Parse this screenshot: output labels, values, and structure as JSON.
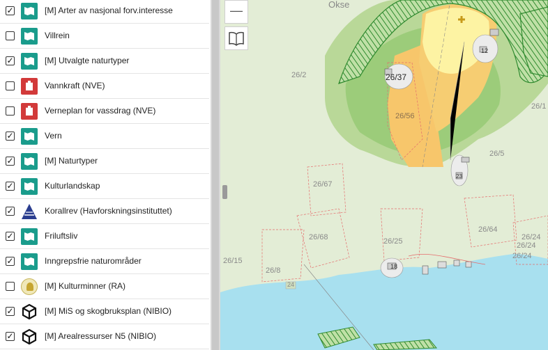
{
  "layers": [
    {
      "label": "[M] Arter av nasjonal forv.interesse",
      "checked": "✓",
      "icon": "teal-map-icon"
    },
    {
      "label": "Villrein",
      "checked": "",
      "icon": "teal-map-icon"
    },
    {
      "label": "[M] Utvalgte naturtyper",
      "checked": "✓",
      "icon": "teal-map-icon"
    },
    {
      "label": "Vannkraft (NVE)",
      "checked": "",
      "icon": "nve-logo-icon"
    },
    {
      "label": "Verneplan for vassdrag (NVE)",
      "checked": "",
      "icon": "nve-logo-icon"
    },
    {
      "label": "Vern",
      "checked": "✓",
      "icon": "teal-map-icon"
    },
    {
      "label": "[M] Naturtyper",
      "checked": "✓",
      "icon": "teal-map-icon"
    },
    {
      "label": "Kulturlandskap",
      "checked": "✓",
      "icon": "teal-map-icon"
    },
    {
      "label": "Korallrev (Havforskningsinstituttet)",
      "checked": "✓",
      "icon": "hi-logo-icon"
    },
    {
      "label": "Friluftsliv",
      "checked": "✓",
      "icon": "teal-map-icon"
    },
    {
      "label": "Inngrepsfrie naturområder",
      "checked": "✓",
      "icon": "teal-map-icon"
    },
    {
      "label": "[M] Kulturminner (RA)",
      "checked": "",
      "icon": "ra-logo-icon"
    },
    {
      "label": "[M] MiS og skogbruksplan (NIBIO)",
      "checked": "✓",
      "icon": "nibio-logo-icon"
    },
    {
      "label": "[M] Arealressurser N5 (NIBIO)",
      "checked": "✓",
      "icon": "nibio-logo-icon"
    }
  ],
  "map": {
    "zoom_out_label": "—",
    "place_name": "Okse",
    "labels": [
      "26/2",
      "26/37",
      "26/56",
      "26/5",
      "26/1",
      "26/67",
      "26/68",
      "26/25",
      "26/64",
      "26/15",
      "26/8",
      "26/24",
      "26/24",
      "26/24",
      "12",
      "18",
      "24",
      "23"
    ]
  }
}
